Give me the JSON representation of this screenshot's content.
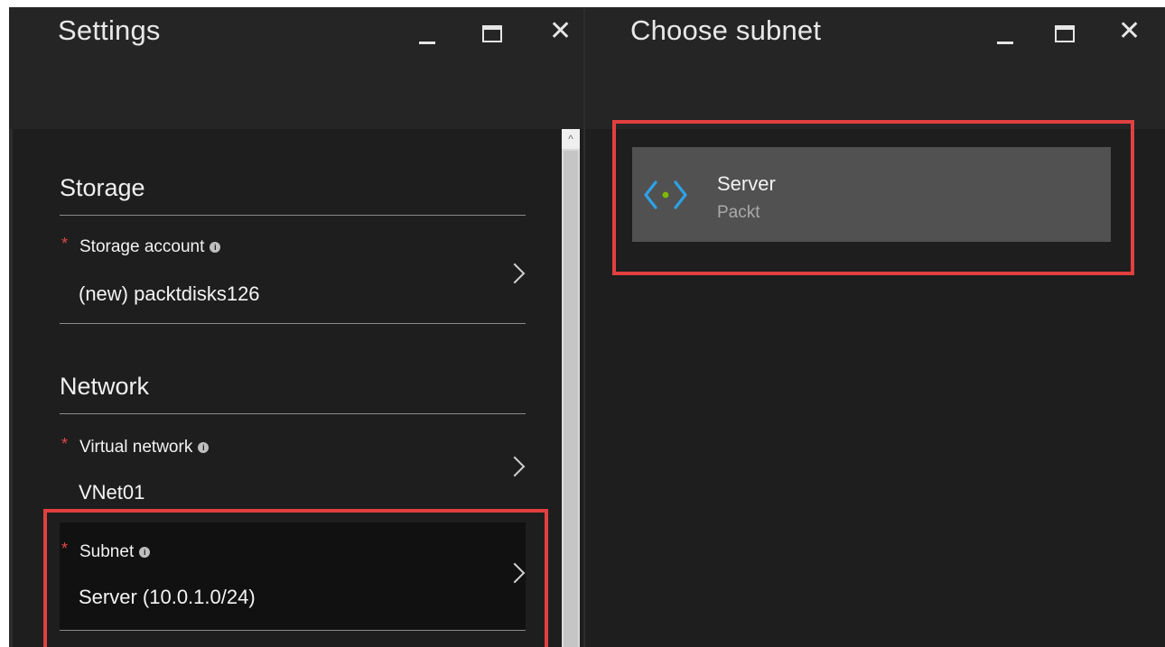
{
  "left_blade": {
    "title": "Settings",
    "controls": {
      "minimize_icon": "minimize-icon",
      "maximize_icon": "maximize-icon",
      "close_glyph": "✕"
    },
    "sections": {
      "storage": {
        "title": "Storage",
        "storage_account": {
          "label": "Storage account",
          "value": "(new) packtdisks126",
          "required": true
        }
      },
      "network": {
        "title": "Network",
        "virtual_network": {
          "label": "Virtual network",
          "value": "VNet01",
          "required": true
        },
        "subnet": {
          "label": "Subnet",
          "value": "Server (10.0.1.0/24)",
          "required": true
        }
      }
    },
    "scroll_up_glyph": "^"
  },
  "right_blade": {
    "title": "Choose subnet",
    "controls": {
      "minimize_icon": "minimize-icon",
      "maximize_icon": "maximize-icon",
      "close_glyph": "✕"
    },
    "subnets": [
      {
        "name": "Server",
        "network": "Packt",
        "icon": "subnet-icon"
      }
    ]
  },
  "common": {
    "required_mark": "*",
    "info_mark": "i"
  },
  "colors": {
    "highlight": "#e0403f",
    "required": "#e04848",
    "icon_blue": "#2ea1e8",
    "icon_green": "#7fba00"
  }
}
